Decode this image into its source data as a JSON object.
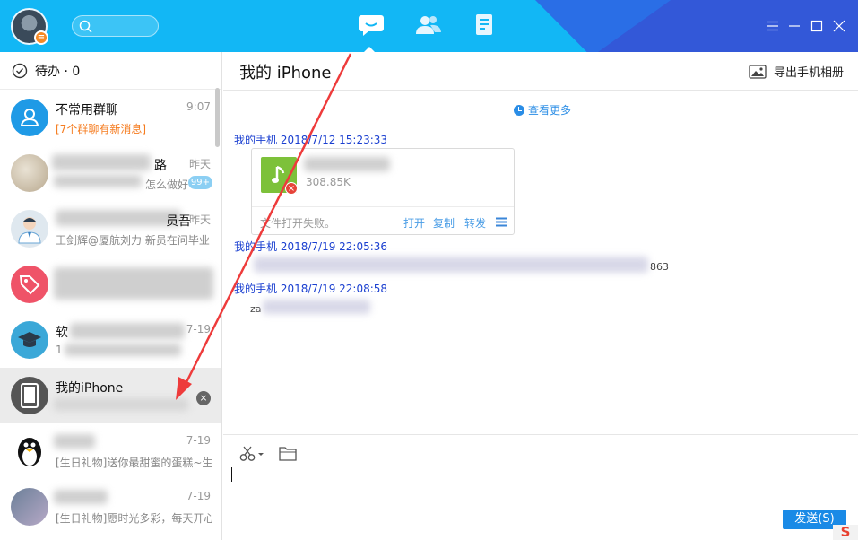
{
  "topbar": {
    "status_symbol": "=",
    "nav": [
      "chat-icon",
      "contacts-icon",
      "notes-icon"
    ],
    "window_buttons": [
      "menu-icon",
      "minimize-icon",
      "maximize-icon",
      "close-icon"
    ]
  },
  "sidebar": {
    "todo_label": "待办 · 0",
    "conversations": [
      {
        "name": "不常用群聊",
        "message": "[7个群聊有新消息]",
        "time": "9:07"
      },
      {
        "name": "路",
        "message": "怎么做好",
        "time": "昨天",
        "badge": "99+"
      },
      {
        "name": "员吾",
        "message": "王剑辉@厦航刘力 新员在问毕业",
        "time": "昨天"
      },
      {
        "name": "",
        "message": "",
        "time": ""
      },
      {
        "name": "软",
        "message": "1",
        "time": "7-19"
      },
      {
        "name": "我的iPhone",
        "message": "",
        "time": "",
        "close": "×"
      },
      {
        "name": "",
        "message": "[生日礼物]送你最甜蜜的蛋糕~生",
        "time": "7-19"
      },
      {
        "name": "",
        "message": "[生日礼物]愿时光多彩，每天开心",
        "time": "7-19"
      }
    ]
  },
  "chat": {
    "title": "我的 iPhone",
    "export_label": "导出手机相册",
    "view_more": "查看更多",
    "messages": [
      {
        "header": "我的手机 2018/7/12 15:23:33"
      },
      {
        "header": "我的手机 2018/7/19 22:05:36",
        "text_tail": "863"
      },
      {
        "header": "我的手机 2018/7/19 22:08:58",
        "text_head": "za"
      }
    ],
    "file": {
      "size": "308.85K",
      "status": "文件打开失败。",
      "actions": [
        "打开",
        "复制",
        "转发"
      ],
      "error_symbol": "×"
    }
  },
  "input": {
    "send_label": "发送(S)"
  },
  "ime_logo": "S"
}
